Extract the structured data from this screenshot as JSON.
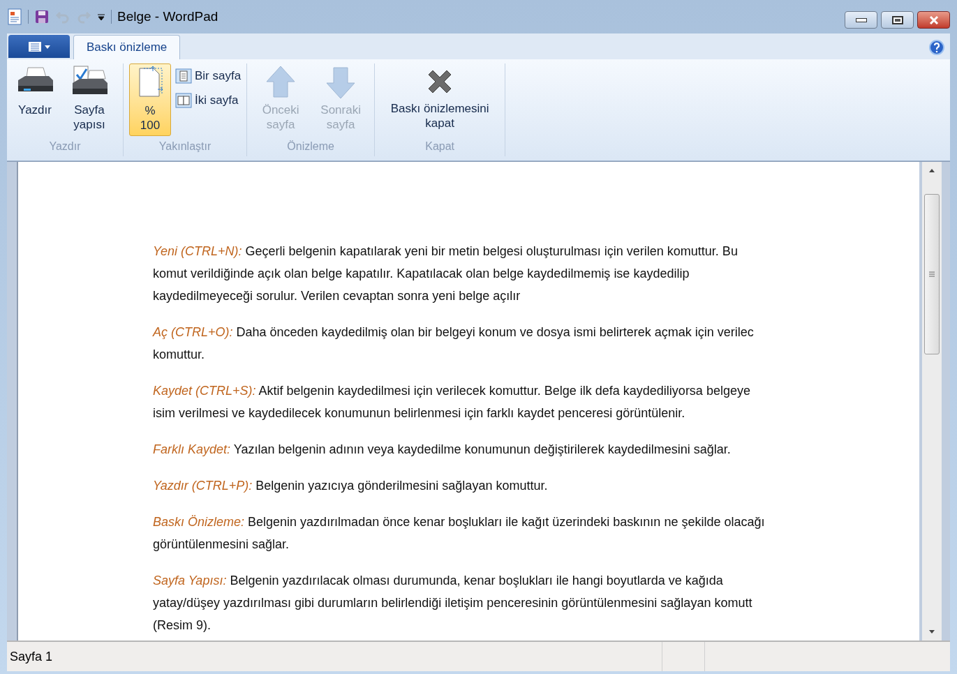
{
  "window": {
    "title": "Belge - WordPad"
  },
  "tabs": [
    {
      "label": "Baskı önizleme",
      "selected": true
    }
  ],
  "ribbon": {
    "groups": [
      {
        "label": "Yazdır",
        "buttons": [
          {
            "kind": "printer",
            "label": "Yazdır",
            "disabled": false
          },
          {
            "kind": "page-setup",
            "label": "Sayfa yapısı",
            "disabled": false
          }
        ]
      },
      {
        "label": "Yakınlaştır",
        "buttons": [
          {
            "kind": "zoom",
            "label": "% 100",
            "selected": true,
            "disabled": false
          },
          {
            "kind": "small-one",
            "label": "Bir sayfa",
            "disabled": false
          },
          {
            "kind": "small-two",
            "label": "İki sayfa",
            "disabled": false
          }
        ]
      },
      {
        "label": "Önizleme",
        "buttons": [
          {
            "kind": "up",
            "label": "Önceki sayfa",
            "disabled": true
          },
          {
            "kind": "down",
            "label": "Sonraki sayfa",
            "disabled": true
          }
        ]
      },
      {
        "label": "Kapat",
        "buttons": [
          {
            "kind": "close",
            "label": "Baskı önizlemesini kapat",
            "disabled": false
          }
        ]
      }
    ]
  },
  "document": {
    "paragraphs": [
      {
        "term": "Yeni (CTRL+N):",
        "lines": [
          " Geçerli belgenin kapatılarak yeni bir metin belgesi oluşturulması için verilen komuttur. Bu",
          "komut verildiğinde açık olan belge kapatılır. Kapatılacak olan belge kaydedilmemiş ise kaydedilip",
          "kaydedilmeyeceği sorulur. Verilen cevaptan sonra yeni belge açılır"
        ]
      },
      {
        "term": "Aç (CTRL+O):",
        "lines": [
          " Daha önceden kaydedilmiş olan bir belgeyi konum ve dosya ismi belirterek açmak için verilec",
          "komuttur."
        ]
      },
      {
        "term": "Kaydet (CTRL+S):",
        "lines": [
          " Aktif belgenin kaydedilmesi için verilecek komuttur. Belge ilk defa kaydediliyorsa belgeye",
          "isim verilmesi ve kaydedilecek konumunun belirlenmesi için farklı kaydet penceresi görüntülenir."
        ]
      },
      {
        "term": "Farklı Kaydet:",
        "lines": [
          " Yazılan belgenin adının veya kaydedilme konumunun değiştirilerek kaydedilmesini sağlar."
        ]
      },
      {
        "term": "Yazdır (CTRL+P):",
        "lines": [
          " Belgenin yazıcıya gönderilmesini sağlayan komuttur."
        ]
      },
      {
        "term": "Baskı Önizleme:",
        "lines": [
          " Belgenin yazdırılmadan önce kenar boşlukları ile kağıt üzerindeki baskının ne şekilde olacağı",
          "görüntülenmesini sağlar."
        ]
      },
      {
        "term": "Sayfa Yapısı:",
        "lines": [
          " Belgenin yazdırılacak olması durumunda, kenar boşlukları ile hangi boyutlarda ve kağıda",
          "yatay/düşey yazdırılması gibi durumların belirlendiği iletişim penceresinin görüntülenmesini sağlayan komutt",
          "(Resim 9)."
        ]
      }
    ]
  },
  "status_bar": {
    "text": "Sayfa 1"
  }
}
